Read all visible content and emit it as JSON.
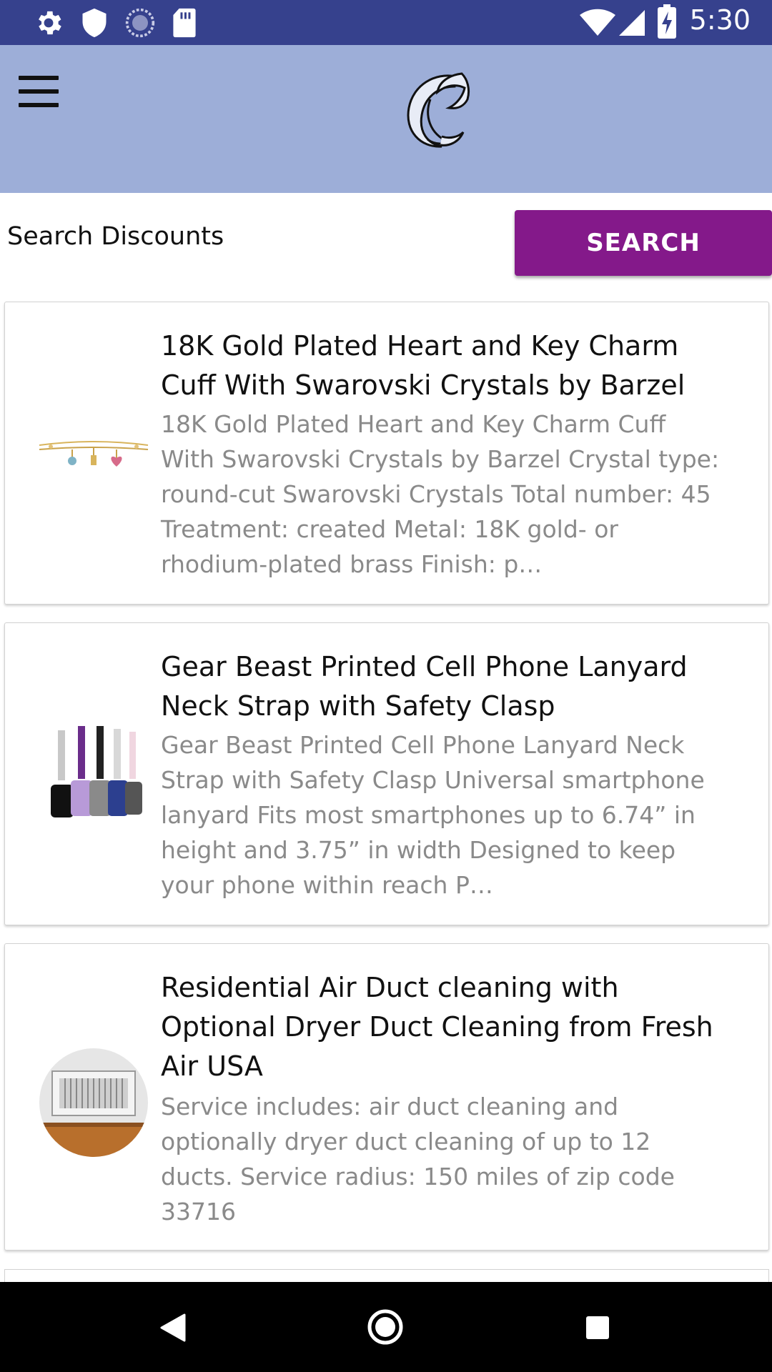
{
  "status_bar": {
    "time": "5:30",
    "icons": [
      "settings-icon",
      "shield-icon",
      "sync-icon",
      "sd-card-icon",
      "wifi-icon",
      "signal-icon",
      "battery-charging-icon"
    ]
  },
  "app_bar": {
    "menu_icon": "hamburger-menu-icon",
    "logo": "app-logo"
  },
  "search": {
    "placeholder": "Search Discounts",
    "button_label": "SEARCH"
  },
  "deals": [
    {
      "title": "18K Gold Plated Heart and Key Charm Cuff With Swarovski Crystals by Barzel",
      "description": "18K Gold Plated Heart and Key Charm Cuff With Swarovski Crystals by Barzel Crystal type: round-cut Swarovski Crystals Total number: 45 Treatment: created Metal: 18K gold- or rhodium-plated brass Finish: p…",
      "image": "bracelet-image"
    },
    {
      "title": "Gear Beast Printed Cell Phone Lanyard Neck Strap with Safety Clasp",
      "description": "Gear Beast Printed Cell Phone Lanyard Neck Strap with Safety Clasp Universal smartphone lanyard Fits most smartphones up to 6.74” in height and 3.75” in width Designed to keep your phone within reach P…",
      "image": "lanyard-image"
    },
    {
      "title": "Residential Air Duct cleaning with Optional Dryer Duct Cleaning from Fresh Air USA",
      "description": "Service includes: air duct cleaning and optionally dryer duct cleaning of up to 12 ducts. Service radius: 150 miles of zip code 33716",
      "image": "air-vent-image"
    }
  ],
  "colors": {
    "status_bar": "#36418d",
    "app_bar": "#9daed8",
    "search_button": "#84198a",
    "description_text": "#8a8a8a"
  },
  "nav_bar": {
    "buttons": [
      "back-icon",
      "home-icon",
      "recents-icon"
    ]
  }
}
